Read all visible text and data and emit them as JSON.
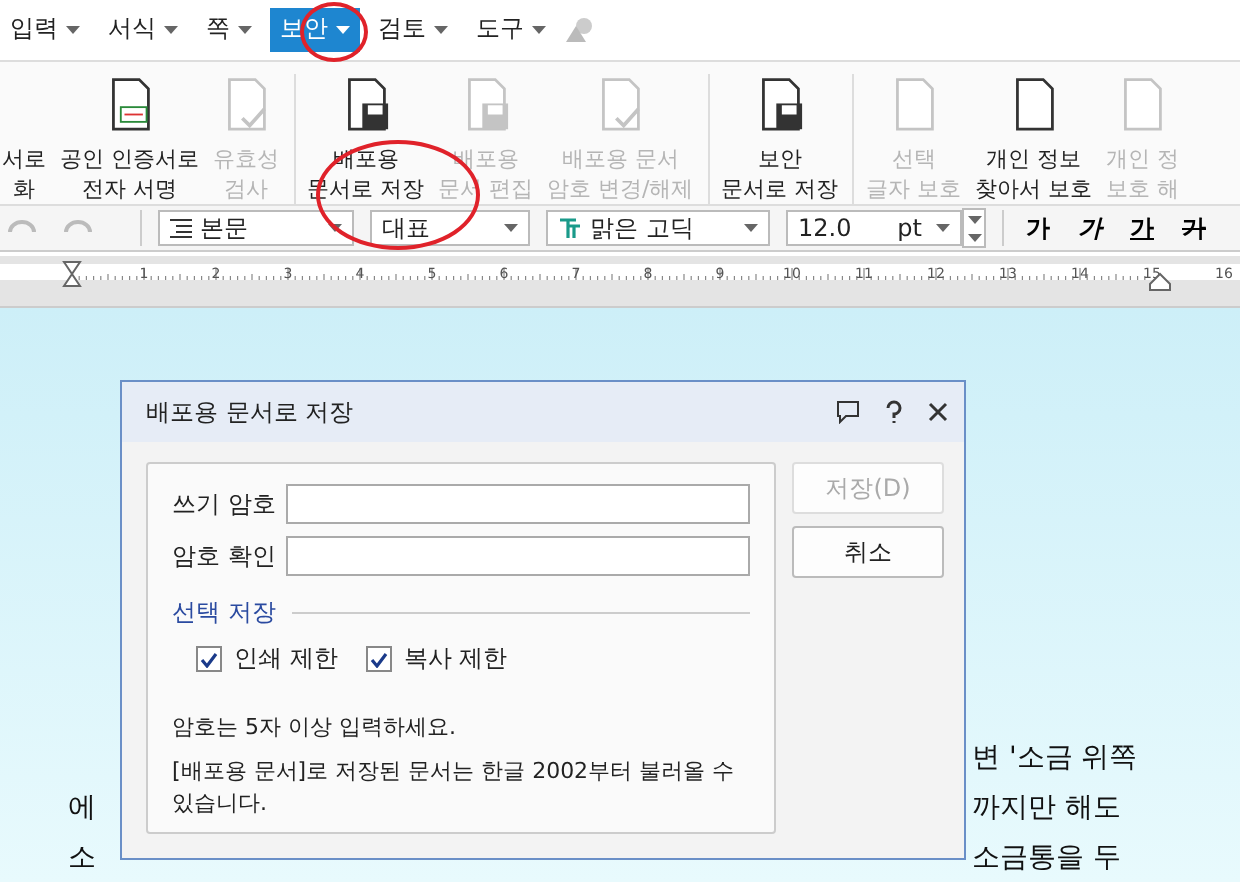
{
  "menu": [
    {
      "label": "입력",
      "selected": false
    },
    {
      "label": "서식",
      "selected": false
    },
    {
      "label": "쪽",
      "selected": false
    },
    {
      "label": "보안",
      "selected": true
    },
    {
      "label": "검토",
      "selected": false
    },
    {
      "label": "도구",
      "selected": false
    }
  ],
  "ribbon": [
    {
      "lines": [
        "서로",
        "화"
      ],
      "disabled": false,
      "sep": false
    },
    {
      "lines": [
        "공인 인증서로",
        "전자 서명"
      ],
      "disabled": false,
      "sep": false
    },
    {
      "lines": [
        "유효성",
        "검사"
      ],
      "disabled": true,
      "sep": false
    },
    {
      "lines": [
        "배포용",
        "문서로 저장"
      ],
      "disabled": false,
      "sep": true
    },
    {
      "lines": [
        "배포용",
        "문서 편집"
      ],
      "disabled": true,
      "sep": false
    },
    {
      "lines": [
        "배포용 문서",
        "암호 변경/해제"
      ],
      "disabled": true,
      "sep": false
    },
    {
      "lines": [
        "보안",
        "문서로 저장"
      ],
      "disabled": false,
      "sep": true
    },
    {
      "lines": [
        "선택",
        "글자 보호"
      ],
      "disabled": true,
      "sep": true
    },
    {
      "lines": [
        "개인 정보",
        "찾아서 보호"
      ],
      "disabled": false,
      "sep": false
    },
    {
      "lines": [
        "개인 정",
        "보호 해"
      ],
      "disabled": true,
      "sep": false
    }
  ],
  "toolbar": {
    "style": "본문",
    "language": "대표",
    "font": "맑은 고딕",
    "size": "12.0",
    "unit": "pt",
    "format_buttons": [
      "가",
      "가",
      "가",
      "가"
    ]
  },
  "ruler": {
    "marks": [
      "1",
      "2",
      "3",
      "4",
      "5",
      "6",
      "7",
      "8",
      "9",
      "10",
      "11",
      "12",
      "13",
      "14",
      "15",
      "16"
    ]
  },
  "document": {
    "lines": [
      {
        "right": "변 '소금 위쪽"
      },
      {
        "left": "에",
        "right": "까지만 해도"
      },
      {
        "left": "소",
        "right": "소금통을 두"
      }
    ]
  },
  "dialog": {
    "title": "배포용 문서로 저장",
    "fields": [
      {
        "label": "쓰기 암호"
      },
      {
        "label": "암호 확인"
      }
    ],
    "group": "선택 저장",
    "options": [
      {
        "label": "인쇄 제한",
        "checked": true
      },
      {
        "label": "복사 제한",
        "checked": true
      }
    ],
    "notes": [
      "암호는 5자 이상 입력하세요.",
      "[배포용 문서]로 저장된 문서는 한글 2002부터 불러올 수 있습니다."
    ],
    "buttons": [
      {
        "label": "저장(D)",
        "disabled": true
      },
      {
        "label": "취소",
        "disabled": false
      }
    ]
  }
}
